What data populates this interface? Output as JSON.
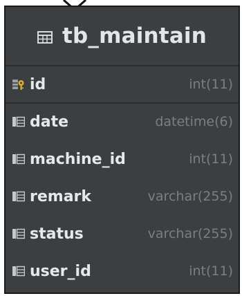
{
  "table": {
    "title": "tb_maintain",
    "primary_key": {
      "name": "id",
      "type": "int(11)"
    },
    "columns": [
      {
        "name": "date",
        "type": "datetime(6)"
      },
      {
        "name": "machine_id",
        "type": "int(11)"
      },
      {
        "name": "remark",
        "type": "varchar(255)"
      },
      {
        "name": "status",
        "type": "varchar(255)"
      },
      {
        "name": "user_id",
        "type": "int(11)"
      }
    ]
  },
  "colors": {
    "background": "#3c3f41",
    "header_text": "#e3e6e8",
    "type_text": "#7b7f83",
    "key_icon": "#e0b02a"
  },
  "icons": {
    "title": "table-icon",
    "primary_key": "primary-key-column-icon",
    "column": "column-icon"
  }
}
